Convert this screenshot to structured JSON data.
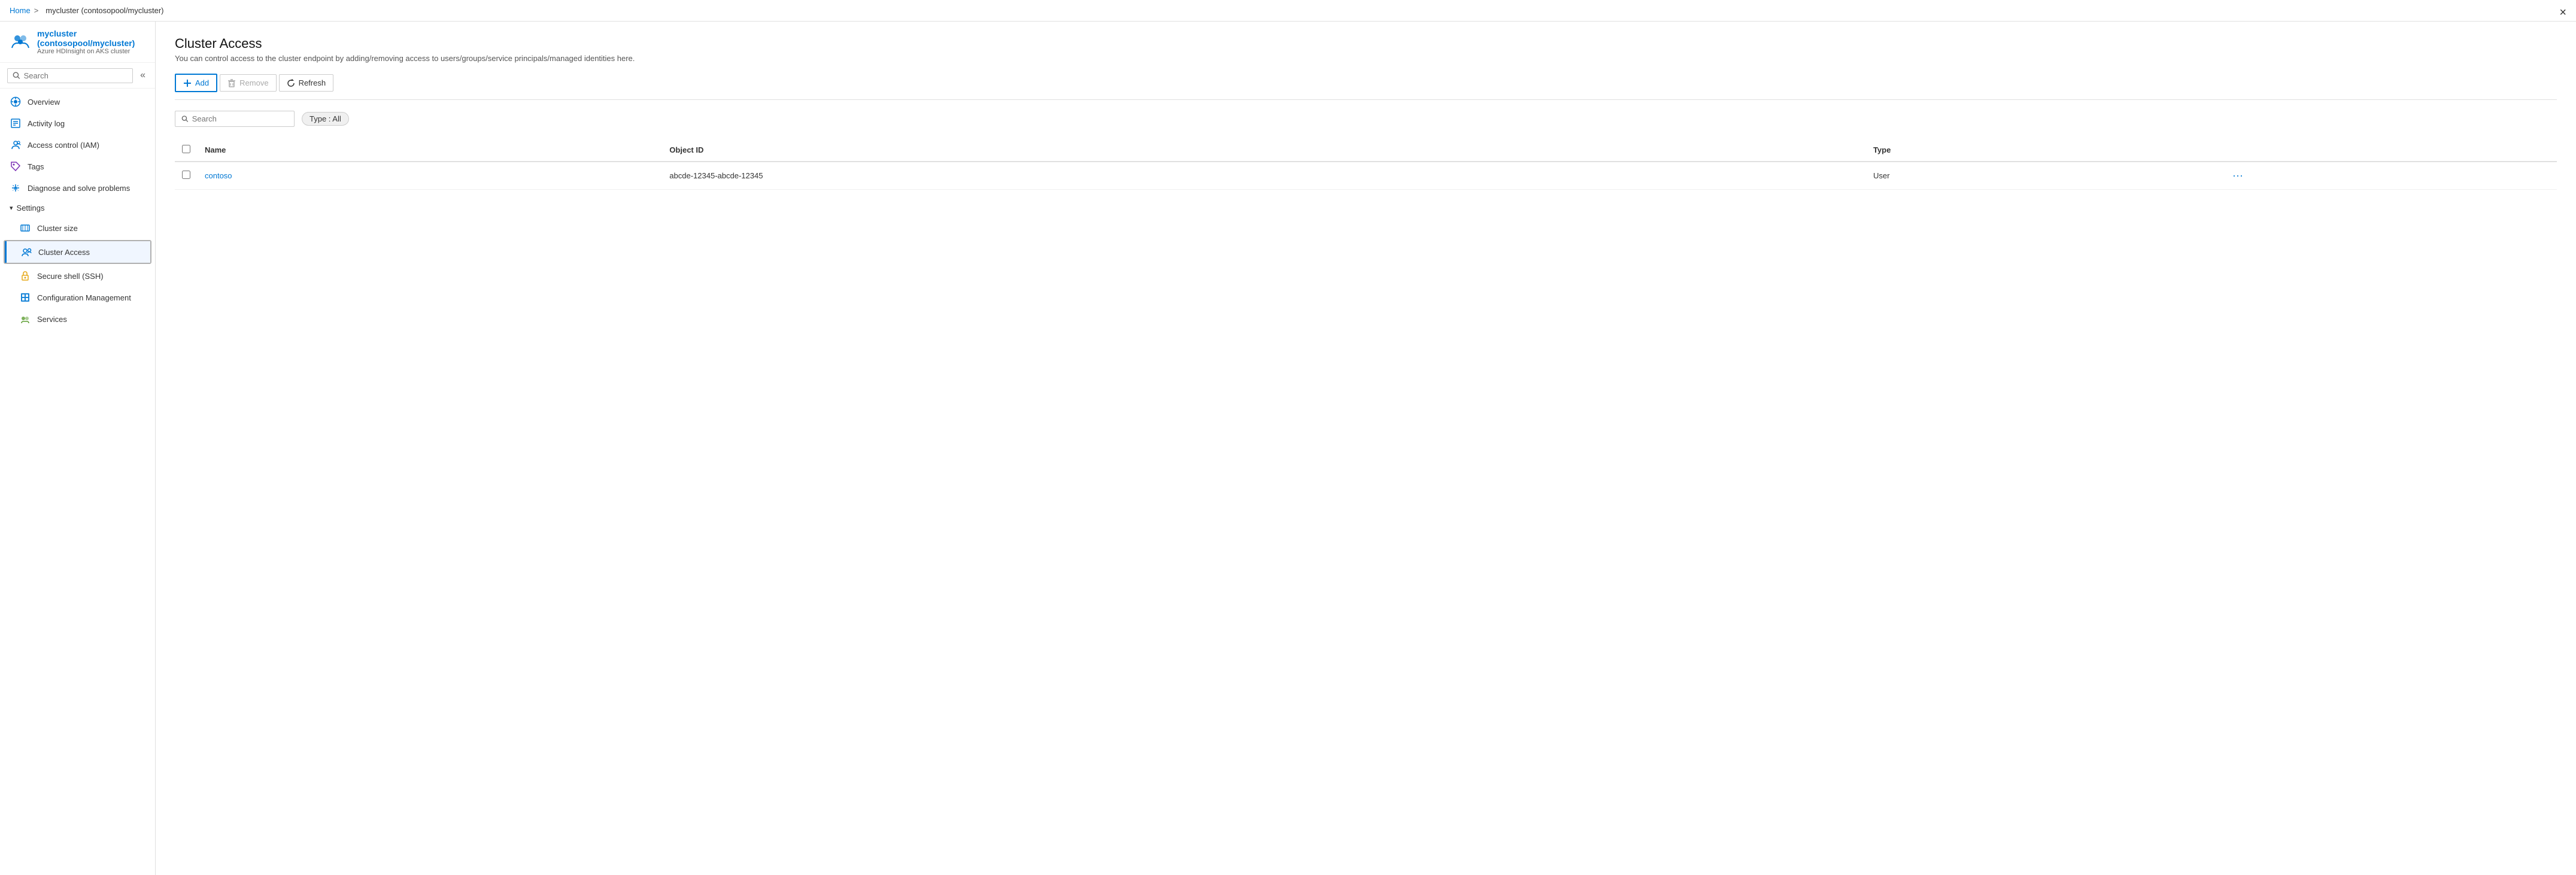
{
  "breadcrumb": {
    "home": "Home",
    "separator": ">",
    "current": "mycluster (contosopool/mycluster)"
  },
  "window": {
    "close_label": "×"
  },
  "sidebar": {
    "header": {
      "title": "mycluster (contosopool/mycluster)",
      "subtitle": "Azure HDInsight on AKS cluster"
    },
    "search_placeholder": "Search",
    "collapse_icon": "«",
    "nav_items": [
      {
        "id": "overview",
        "label": "Overview",
        "icon": "overview"
      },
      {
        "id": "activity-log",
        "label": "Activity log",
        "icon": "activity"
      },
      {
        "id": "access-control",
        "label": "Access control (IAM)",
        "icon": "iam"
      },
      {
        "id": "tags",
        "label": "Tags",
        "icon": "tags"
      },
      {
        "id": "diagnose",
        "label": "Diagnose and solve problems",
        "icon": "diagnose"
      }
    ],
    "settings_section": {
      "label": "Settings",
      "items": [
        {
          "id": "cluster-size",
          "label": "Cluster size",
          "icon": "cluster-size"
        },
        {
          "id": "cluster-access",
          "label": "Cluster Access",
          "icon": "cluster-access",
          "active": true
        },
        {
          "id": "ssh",
          "label": "Secure shell (SSH)",
          "icon": "ssh"
        },
        {
          "id": "config-mgmt",
          "label": "Configuration Management",
          "icon": "config"
        },
        {
          "id": "services",
          "label": "Services",
          "icon": "services"
        }
      ]
    }
  },
  "main": {
    "page_title": "Cluster Access",
    "page_subtitle": "You can control access to the cluster endpoint by adding/removing access to users/groups/service principals/managed identities here.",
    "toolbar": {
      "add_label": "Add",
      "remove_label": "Remove",
      "refresh_label": "Refresh"
    },
    "filter": {
      "search_placeholder": "Search",
      "type_filter_label": "Type : All"
    },
    "table": {
      "columns": [
        {
          "id": "name",
          "label": "Name"
        },
        {
          "id": "object-id",
          "label": "Object ID"
        },
        {
          "id": "type",
          "label": "Type"
        }
      ],
      "rows": [
        {
          "name": "contoso",
          "object_id": "abcde-12345-abcde-12345",
          "type": "User"
        }
      ]
    }
  }
}
